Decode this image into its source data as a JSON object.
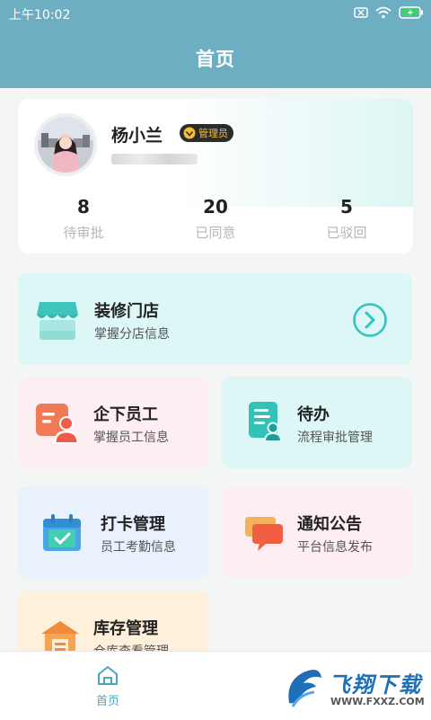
{
  "status_bar": {
    "time": "上午10:02"
  },
  "header": {
    "title": "首页"
  },
  "profile": {
    "name": "杨小兰",
    "role_badge": "管理员",
    "stats": [
      {
        "value": "8",
        "label": "待审批"
      },
      {
        "value": "20",
        "label": "已同意"
      },
      {
        "value": "5",
        "label": "已驳回"
      }
    ]
  },
  "cards": {
    "store": {
      "title": "装修门店",
      "subtitle": "掌握分店信息"
    },
    "staff": {
      "title": "企下员工",
      "subtitle": "掌握员工信息"
    },
    "todo": {
      "title": "待办",
      "subtitle": "流程审批管理"
    },
    "attendance": {
      "title": "打卡管理",
      "subtitle": "员工考勤信息"
    },
    "notice": {
      "title": "通知公告",
      "subtitle": "平台信息发布"
    },
    "inventory": {
      "title": "库存管理",
      "subtitle": "仓库查看管理"
    }
  },
  "tabbar": {
    "home_label": "首页"
  },
  "watermark": {
    "text": "飞翔下载",
    "url": "WWW.FXXZ.COM"
  },
  "colors": {
    "header_bg": "#6daec2",
    "accent_teal": "#2ec4c0",
    "store_bg": "#dcf7f5",
    "staff_bg": "#fdeef2",
    "todo_bg": "#dcf7f5",
    "attendance_bg": "#e9f2fc",
    "notice_bg": "#fdeef2",
    "inventory_bg": "#fff0dc"
  }
}
